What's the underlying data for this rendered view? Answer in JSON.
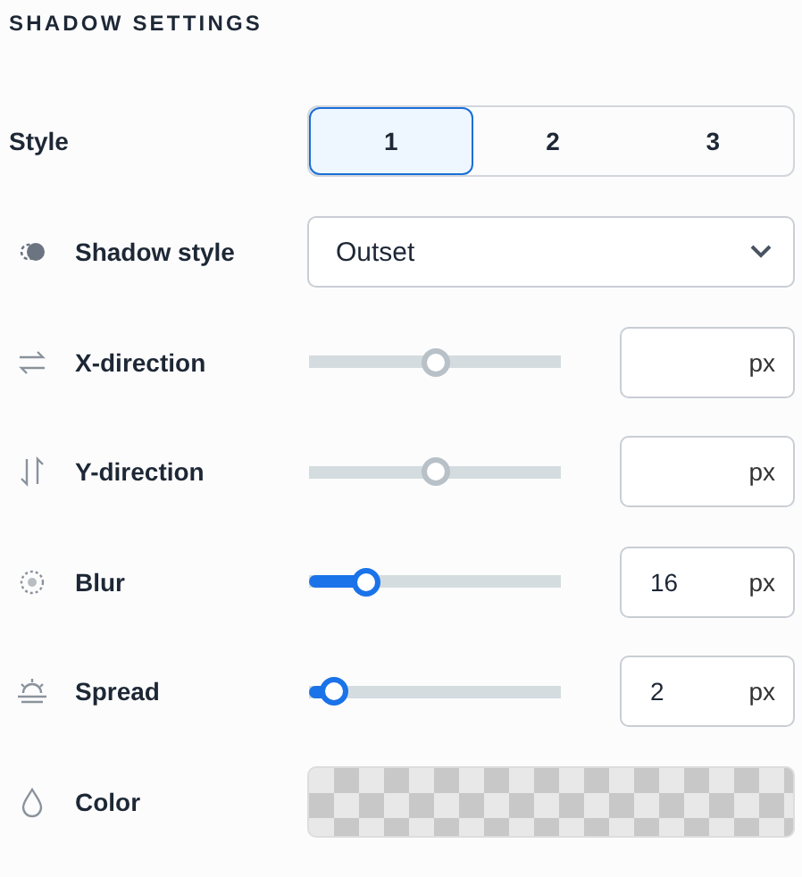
{
  "heading": "SHADOW SETTINGS",
  "style": {
    "label": "Style",
    "options": [
      {
        "label": "1",
        "selected": true
      },
      {
        "label": "2",
        "selected": false
      },
      {
        "label": "3",
        "selected": false
      }
    ]
  },
  "rows": [
    {
      "kind": "select",
      "label": "Shadow style",
      "value": "Outset"
    },
    {
      "kind": "slider",
      "label": "X-direction",
      "level": 0.5,
      "active": false,
      "value": "",
      "unit": "px"
    },
    {
      "kind": "slider",
      "label": "Y-direction",
      "level": 0.5,
      "active": false,
      "value": "",
      "unit": "px"
    },
    {
      "kind": "slider",
      "label": "Blur",
      "level": 0.19,
      "active": true,
      "value": "16",
      "unit": "px"
    },
    {
      "kind": "slider",
      "label": "Spread",
      "level": 0.05,
      "active": true,
      "value": "2",
      "unit": "px"
    },
    {
      "kind": "color",
      "label": "Color"
    }
  ]
}
